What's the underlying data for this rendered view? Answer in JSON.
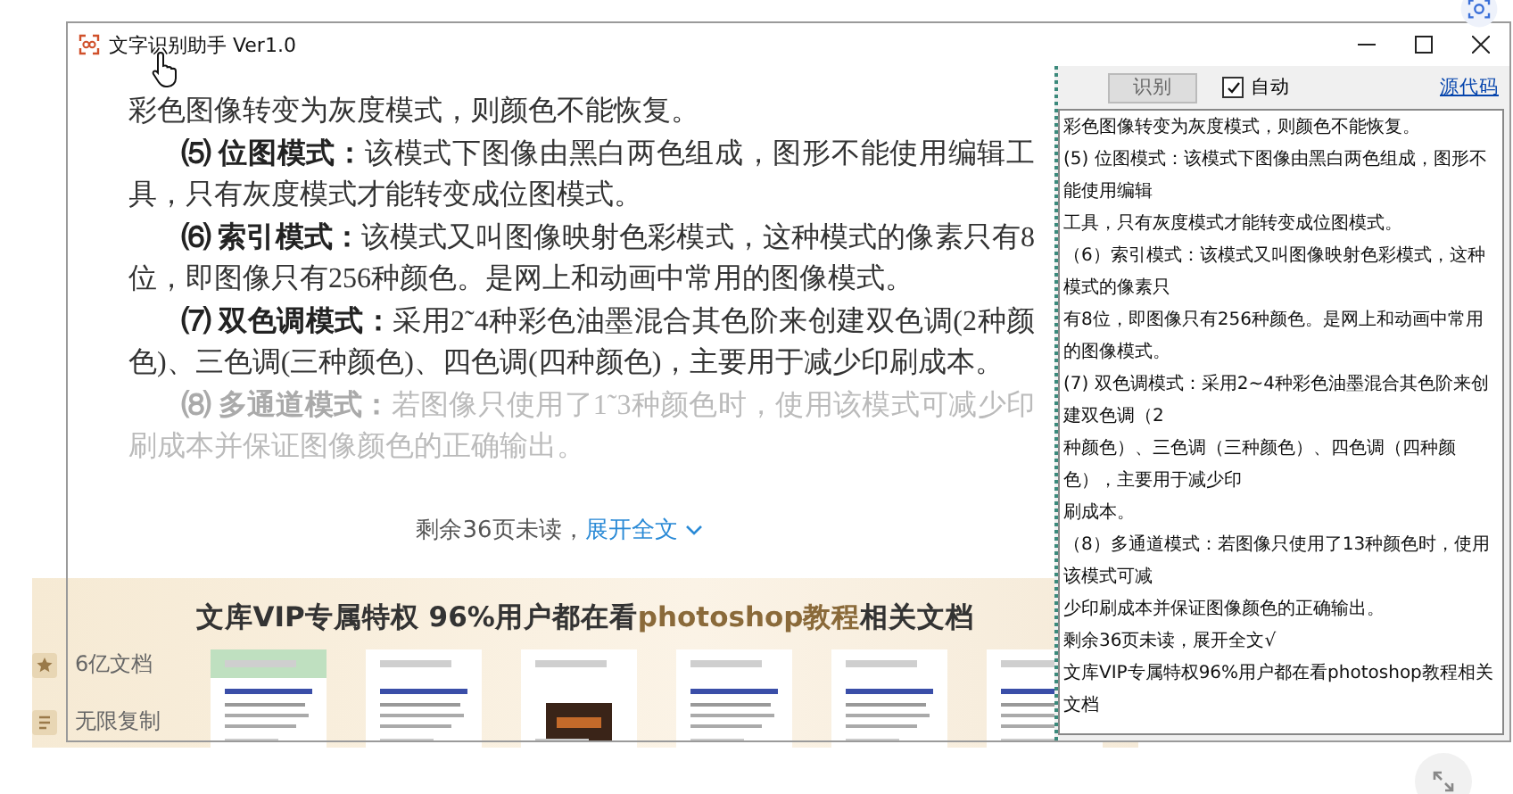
{
  "page": {
    "document": {
      "paragraphs": [
        {
          "kind": "continuation",
          "text": "彩色图像转变为灰度模式，则颜色不能恢复。",
          "faded": false
        },
        {
          "kind": "section",
          "text": "**⑸ 位图模式：**该模式下图像由黑白两色组成，图形不能使用编辑工具，只有灰度模式才能转变成位图模式。",
          "faded": false
        },
        {
          "kind": "section",
          "text": "**⑹ 索引模式：**该模式又叫图像映射色彩模式，这种模式的像素只有8位，即图像只有256种颜色。是网上和动画中常用的图像模式。",
          "faded": false
        },
        {
          "kind": "section",
          "text": "**⑺ 双色调模式：**采用2˜4种彩色油墨混合其色阶来创建双色调(2种颜色)、三色调(三种颜色)、四色调(四种颜色)，主要用于减少印刷成本。",
          "faded": false
        },
        {
          "kind": "section",
          "text": "**⑻ 多通道模式：**若图像只使用了1˜3种颜色时，使用该模式可减少印刷成本并保证图像颜色的正确输出。",
          "faded": true
        }
      ]
    },
    "remaining": {
      "text": "剩余36页未读，",
      "link": "展开全文"
    },
    "vip_banner": {
      "title_prefix": "文库VIP专属特权 96%用户都在看",
      "title_highlight": "photoshop教程",
      "title_suffix": "相关文档",
      "perks": [
        {
          "label": "6亿文档"
        },
        {
          "label": "无限复制"
        }
      ]
    }
  },
  "window": {
    "title": "文字识别助手 Ver1.0",
    "recognize_button": "识别",
    "auto": {
      "label": "自动",
      "checked": true
    },
    "source_link": "源代码",
    "output_lines": [
      "彩色图像转变为灰度模式，则颜色不能恢复。",
      "(5) 位图模式：该模式下图像由黑白两色组成，图形不能使用编辑",
      "工具，只有灰度模式才能转变成位图模式。",
      "（6）索引模式：该模式又叫图像映射色彩模式，这种模式的像素只",
      "有8位，即图像只有256种颜色。是网上和动画中常用的图像模式。",
      "(7) 双色调模式：采用2~4种彩色油墨混合其色阶来创建双色调（2",
      "种颜色）、三色调（三种颜色）、四色调（四种颜色），主要用于减少印",
      "刷成本。",
      "（8）多通道模式：若图像只使用了13种颜色时，使用该模式可减",
      "少印刷成本并保证图像颜色的正确输出。",
      "剩余36页未读，展开全文√",
      "文库VIP专属特权96%用户都在看photoshop教程相关文档"
    ]
  }
}
